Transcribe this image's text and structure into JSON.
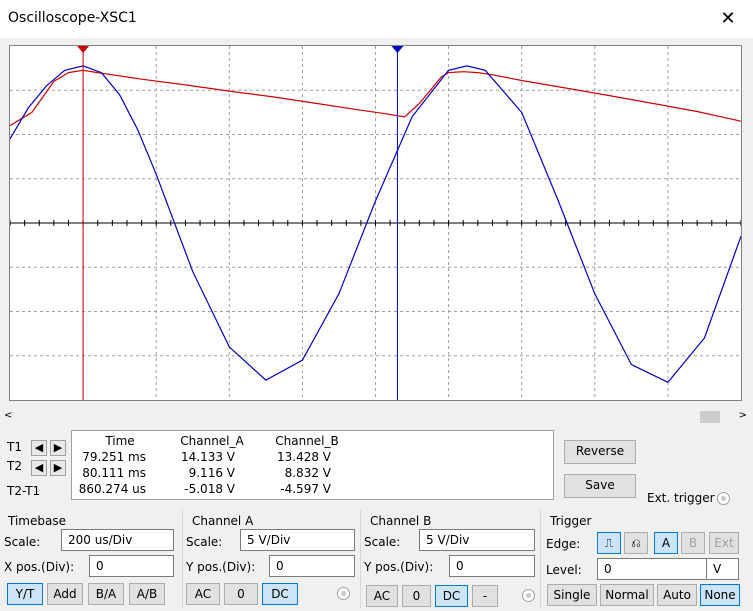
{
  "window": {
    "title": "Oscilloscope-XSC1"
  },
  "icons": {
    "close": "close-icon",
    "scroll_left": "arrow-left-icon",
    "scroll_right": "arrow-right-icon",
    "cursor1": "cursor-1-marker-icon",
    "cursor2": "cursor-2-marker-icon",
    "rising_edge": "rising-edge-icon",
    "falling_edge": "falling-edge-icon"
  },
  "colors": {
    "channel_a": "#cc0000",
    "channel_b": "#0000c0",
    "grid": "#a0a0a0",
    "cursor1": "#cc0000",
    "cursor2": "#0000c0"
  },
  "cursor_rows": [
    {
      "label": "T1"
    },
    {
      "label": "T2"
    },
    {
      "label": "T2-T1"
    }
  ],
  "readout": {
    "headers": [
      "Time",
      "Channel_A",
      "Channel_B"
    ],
    "rows": [
      [
        "79.251 ms",
        "14.133 V",
        "13.428 V"
      ],
      [
        "80.111 ms",
        "9.116 V",
        "8.832 V"
      ],
      [
        "860.274 us",
        "-5.018 V",
        "-4.597 V"
      ]
    ]
  },
  "actions": {
    "reverse": "Reverse",
    "save": "Save",
    "ext_trigger": "Ext. trigger"
  },
  "timebase": {
    "title": "Timebase",
    "scale_label": "Scale:",
    "scale_value": "200 us/Div",
    "xpos_label": "X pos.(Div):",
    "xpos_value": "0",
    "modes": [
      "Y/T",
      "Add",
      "B/A",
      "A/B"
    ],
    "selected_mode": "Y/T"
  },
  "channel_a": {
    "title": "Channel A",
    "scale_label": "Scale:",
    "scale_value": "5  V/Div",
    "ypos_label": "Y pos.(Div):",
    "ypos_value": "0",
    "coupling": [
      "AC",
      "0",
      "DC"
    ],
    "selected": "DC"
  },
  "channel_b": {
    "title": "Channel B",
    "scale_label": "Scale:",
    "scale_value": "5  V/Div",
    "ypos_label": "Y pos.(Div):",
    "ypos_value": "0",
    "coupling": [
      "AC",
      "0",
      "DC",
      "-"
    ],
    "selected": "DC"
  },
  "trigger": {
    "title": "Trigger",
    "edge_label": "Edge:",
    "sources": [
      "A",
      "B",
      "Ext"
    ],
    "selected_source": "A",
    "level_label": "Level:",
    "level_value": "0",
    "level_unit": "V",
    "modes": [
      "Single",
      "Normal",
      "Auto",
      "None"
    ],
    "selected_mode": "None"
  },
  "chart_data": {
    "type": "line",
    "xlim": [
      0,
      10
    ],
    "ylim": [
      -4,
      4
    ],
    "grid": true,
    "series": [
      {
        "x": [
          0,
          0.3,
          0.6,
          0.8,
          1.0,
          1.2,
          1.4,
          1.8,
          2.4,
          3.0,
          3.6,
          4.2,
          4.8,
          5.1,
          5.4,
          5.6,
          5.9,
          6.0,
          6.2,
          6.4,
          6.6,
          7.0,
          7.6,
          8.2,
          8.8,
          9.4,
          10
        ],
        "y": [
          2.2,
          2.5,
          3.2,
          3.4,
          3.45,
          3.4,
          3.35,
          3.25,
          3.12,
          2.98,
          2.85,
          2.7,
          2.55,
          2.48,
          2.4,
          2.7,
          3.3,
          3.4,
          3.42,
          3.4,
          3.35,
          3.22,
          3.05,
          2.88,
          2.7,
          2.52,
          2.3
        ]
      },
      {
        "x": [
          0,
          0.25,
          0.5,
          0.75,
          1.0,
          1.25,
          1.5,
          1.75,
          2.0,
          2.5,
          3.0,
          3.5,
          4.0,
          4.5,
          5.0,
          5.5,
          6.0,
          6.25,
          6.5,
          7.0,
          7.5,
          8.0,
          8.5,
          9.0,
          9.5,
          10
        ],
        "y": [
          1.9,
          2.6,
          3.1,
          3.45,
          3.55,
          3.4,
          2.9,
          2.1,
          1.1,
          -1.1,
          -2.8,
          -3.55,
          -3.1,
          -1.6,
          0.5,
          2.4,
          3.45,
          3.55,
          3.45,
          2.5,
          0.5,
          -1.6,
          -3.2,
          -3.6,
          -2.6,
          -0.3
        ]
      }
    ],
    "cursor_times": [
      1.0,
      5.3
    ]
  }
}
